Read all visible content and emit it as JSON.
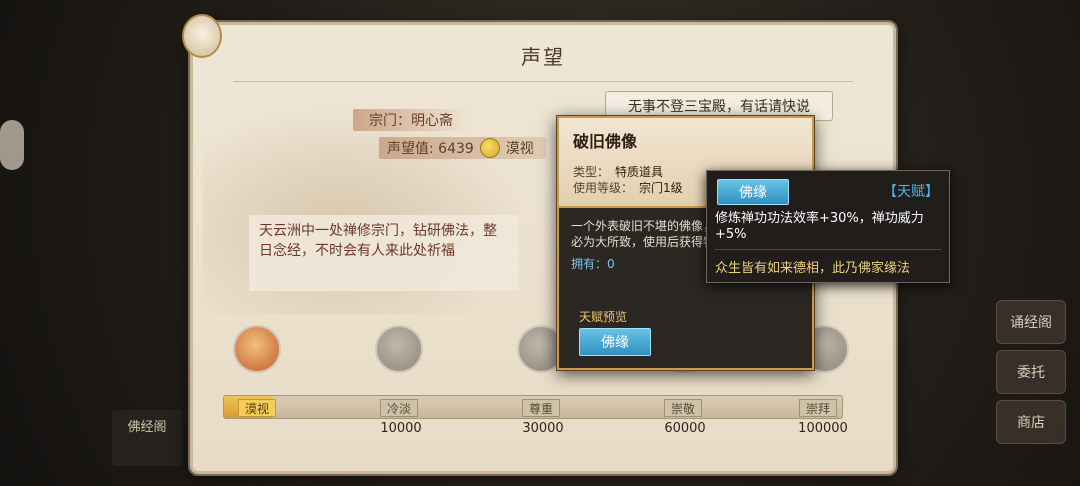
{
  "panel": {
    "title": "声望"
  },
  "speech": "无事不登三宝殿，有话请快说",
  "sect": {
    "label": "宗门：明心斋"
  },
  "reputation": {
    "label": "声望值: 6439",
    "status": "漠视"
  },
  "description": "天云洲中一处禅修宗门，钻研佛法，整日念经，不时会有人来此处祈福",
  "milestones": [
    {
      "label": "漠视",
      "value": "",
      "active": true
    },
    {
      "label": "冷淡",
      "value": "10000",
      "active": false
    },
    {
      "label": "尊重",
      "value": "30000",
      "active": false
    },
    {
      "label": "崇敬",
      "value": "60000",
      "active": false
    },
    {
      "label": "崇拜",
      "value": "100000",
      "active": false
    }
  ],
  "progress": 0.08,
  "side_buttons": [
    "诵经阁",
    "委托",
    "商店"
  ],
  "left_strip": "佛经阁",
  "item": {
    "name": "破旧佛像",
    "type_label": "类型：",
    "type_value": "特质道具",
    "level_label": "使用等级：",
    "level_value": "宗门1级",
    "description": "一个外表破旧不堪的佛像，着深厚佛缘，其必为大所致，使用后获得特质",
    "owned": "拥有：0",
    "talent_preview_label": "天赋预览",
    "talent_button": "佛缘"
  },
  "tooltip": {
    "button": "佛缘",
    "tag": "【天赋】",
    "effect": "修炼禅功功法效率+30%，禅功威力+5%",
    "flavor": "众生皆有如来德相，此乃佛家缘法"
  },
  "colors": {
    "accent_blue": "#2f8fbf",
    "gold": "#c99a4f",
    "parchment": "#efe6d6",
    "tooltip_tag": "#4ab4ea"
  }
}
